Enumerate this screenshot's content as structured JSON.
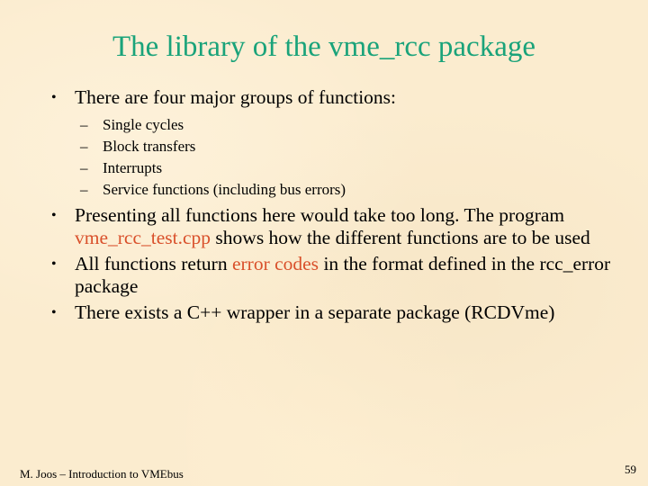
{
  "slide": {
    "title": "The library of the vme_rcc package",
    "bullets": [
      {
        "text": "There are four major groups of functions:",
        "subitems": [
          "Single cycles",
          "Block transfers",
          "Interrupts",
          "Service functions (including bus errors)"
        ]
      },
      {
        "parts": [
          "Presenting all functions here would take too long. The program ",
          "vme_rcc_test.cpp",
          " shows how the different functions are to be used"
        ]
      },
      {
        "parts": [
          "All functions return ",
          "error codes",
          " in the format defined in the rcc_error package"
        ]
      },
      {
        "text": "There exists a C++ wrapper in a separate package (RCDVme)"
      }
    ],
    "bullet_glyph": "•",
    "dash_glyph": "–"
  },
  "footer": {
    "author_title": "M. Joos – Introduction to VMEbus",
    "page_number": "59"
  },
  "colors": {
    "title": "#1aa37a",
    "highlight": "#d9502b",
    "background": "#fbeccf"
  }
}
